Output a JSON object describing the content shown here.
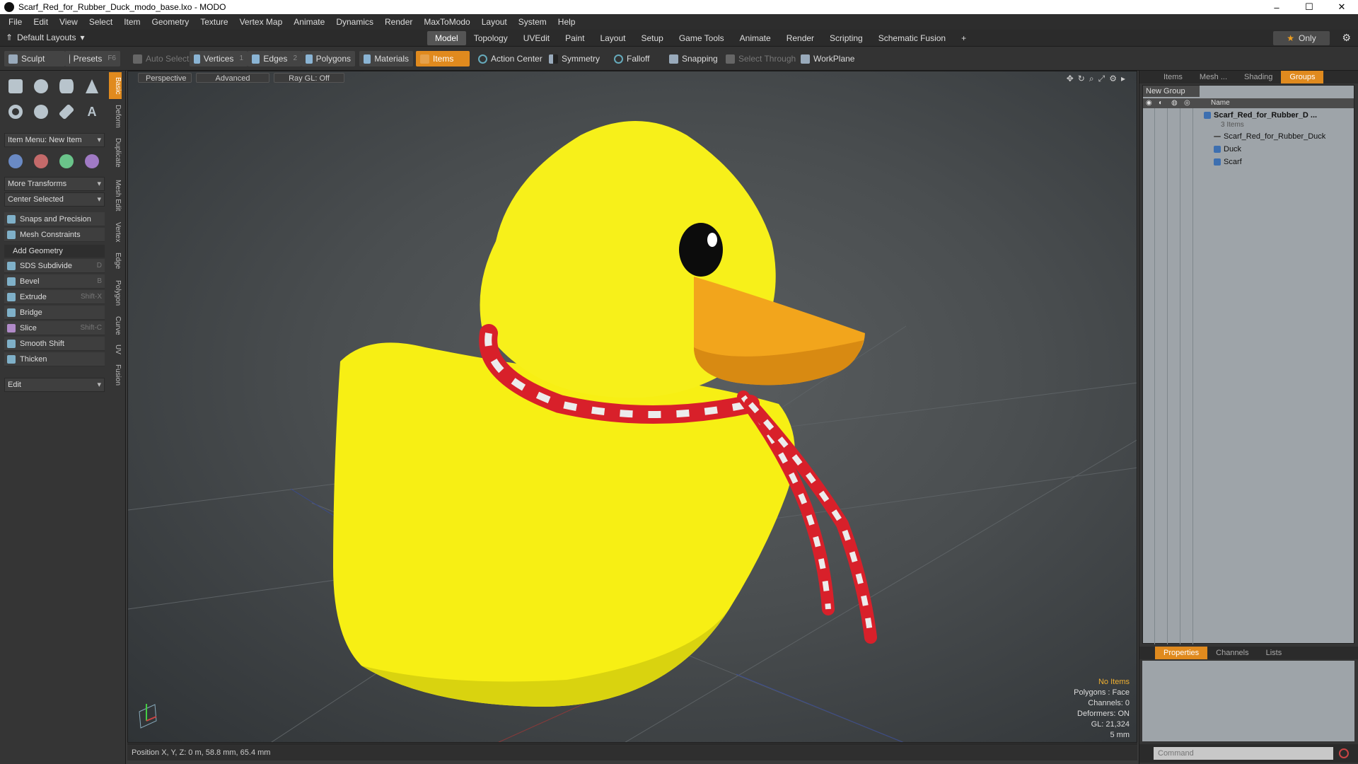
{
  "window": {
    "title": "Scarf_Red_for_Rubber_Duck_modo_base.lxo - MODO",
    "minimize": "–",
    "maximize": "☐",
    "close": "✕"
  },
  "menu": [
    "File",
    "Edit",
    "View",
    "Select",
    "Item",
    "Geometry",
    "Texture",
    "Vertex Map",
    "Animate",
    "Dynamics",
    "Render",
    "MaxToModo",
    "Layout",
    "System",
    "Help"
  ],
  "layout_bar": {
    "default_layouts": "Default Layouts",
    "tabs": [
      "Model",
      "Topology",
      "UVEdit",
      "Paint",
      "Layout",
      "Setup",
      "Game Tools",
      "Animate",
      "Render",
      "Scripting",
      "Schematic Fusion"
    ],
    "active_tab": "Model",
    "add": "+",
    "only": "Only"
  },
  "toolbar": {
    "sculpt": "Sculpt",
    "presets": "Presets",
    "presets_key": "F6",
    "auto_select": "Auto Select",
    "vertices": "Vertices",
    "vertices_num": "1",
    "edges": "Edges",
    "edges_num": "2",
    "polygons": "Polygons",
    "materials": "Materials",
    "items": "Items",
    "action_center": "Action Center",
    "symmetry": "Symmetry",
    "falloff": "Falloff",
    "snapping": "Snapping",
    "select_through": "Select Through",
    "workplane": "WorkPlane"
  },
  "left_panel": {
    "item_menu": "Item Menu: New Item",
    "more_transforms": "More Transforms",
    "center_selected": "Center Selected",
    "snaps": "Snaps and Precision",
    "mesh_constraints": "Mesh Constraints",
    "add_geometry": "Add Geometry",
    "tools": [
      {
        "label": "SDS Subdivide",
        "shortcut": "D"
      },
      {
        "label": "Bevel",
        "shortcut": "B"
      },
      {
        "label": "Extrude",
        "shortcut": "Shift-X"
      },
      {
        "label": "Bridge",
        "shortcut": ""
      },
      {
        "label": "Slice",
        "shortcut": "Shift-C"
      },
      {
        "label": "Smooth Shift",
        "shortcut": ""
      },
      {
        "label": "Thicken",
        "shortcut": ""
      }
    ],
    "edit": "Edit",
    "vertical_tabs": [
      "Basic",
      "Deform",
      "Duplicate",
      "Mesh Edit",
      "Vertex",
      "Edge",
      "Polygon",
      "Curve",
      "UV",
      "Fusion"
    ]
  },
  "viewport": {
    "view": "Perspective",
    "advanced": "Advanced",
    "raygl": "Ray GL: Off",
    "hud": {
      "selection": "No Items",
      "polygons": "Polygons : Face",
      "channels": "Channels: 0",
      "deformers": "Deformers: ON",
      "gl": "GL: 21,324",
      "scale": "5 mm"
    }
  },
  "status": {
    "position": "Position X, Y, Z:  0 m, 58.8 mm, 65.4 mm"
  },
  "right_panel": {
    "top_tabs": [
      "Items",
      "Mesh ...",
      "Shading",
      "Groups"
    ],
    "active_top": "Groups",
    "new_group": "New Group",
    "name_col": "Name",
    "group_name": "Scarf_Red_for_Rubber_D ...",
    "group_count": "3 Items",
    "children": [
      "Scarf_Red_for_Rubber_Duck",
      "Duck",
      "Scarf"
    ],
    "bottom_tabs": [
      "Properties",
      "Channels",
      "Lists"
    ],
    "active_bottom": "Properties",
    "command_placeholder": "Command"
  },
  "colors": {
    "accent": "#e08a1e",
    "duck": "#f7f01a",
    "beak": "#f2a51c",
    "scarf_red": "#d8202a",
    "scarf_white": "#e8e8e8"
  }
}
